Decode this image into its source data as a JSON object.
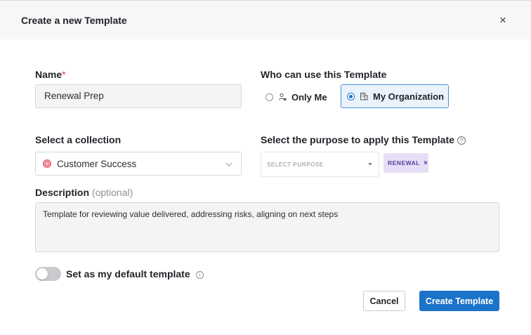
{
  "dialog": {
    "title": "Create a new Template",
    "close_label": "×"
  },
  "name": {
    "label": "Name",
    "required_mark": "*",
    "value": "Renewal Prep"
  },
  "access": {
    "label": "Who can use this Template",
    "options": [
      {
        "label": "Only Me",
        "icon": "person-lock-icon",
        "selected": false
      },
      {
        "label": "My Organization",
        "icon": "building-icon",
        "selected": true
      }
    ]
  },
  "collection": {
    "label": "Select a collection",
    "value": "Customer Success",
    "icon": "target-icon",
    "icon_color": "#e0455a"
  },
  "purpose": {
    "label": "Select the purpose to apply this Template",
    "help_glyph": "?",
    "placeholder": "SELECT PURPOSE",
    "tags": [
      {
        "label": "RENEWAL",
        "remove_glyph": "×"
      }
    ]
  },
  "description": {
    "label": "Description",
    "optional_label": "(optional)",
    "value": "Template for reviewing value delivered, addressing risks, aligning on next steps"
  },
  "default_toggle": {
    "label": "Set as my default template",
    "info_glyph": "i",
    "on": false
  },
  "actions": {
    "cancel_label": "Cancel",
    "create_label": "Create Template"
  },
  "colors": {
    "primary": "#1a73c9",
    "tag_bg": "#e6def7",
    "tag_text": "#5a3e9c",
    "required": "#d93a3a"
  }
}
